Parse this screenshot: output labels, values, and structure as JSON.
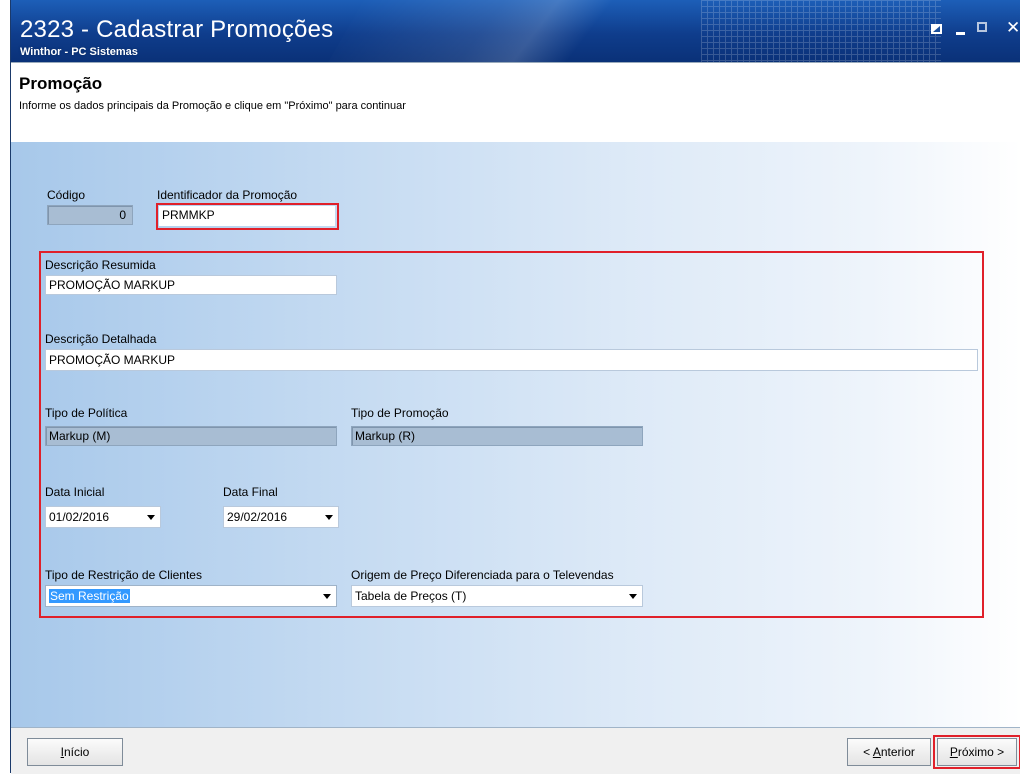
{
  "window": {
    "title": "2323 - Cadastrar Promoções",
    "subtitle": "Winthor - PC Sistemas"
  },
  "header": {
    "title": "Promoção",
    "description": "Informe os dados principais da Promoção e clique em \"Próximo\" para continuar"
  },
  "form": {
    "codigo": {
      "label": "Código",
      "value": "0"
    },
    "identificador": {
      "label": "Identificador da Promoção",
      "value": "PRMMKP"
    },
    "descricao_resumida": {
      "label": "Descrição Resumida",
      "value": "PROMOÇÃO MARKUP"
    },
    "descricao_detalhada": {
      "label": "Descrição Detalhada",
      "value": "PROMOÇÃO MARKUP"
    },
    "tipo_politica": {
      "label": "Tipo de Política",
      "value": "Markup (M)"
    },
    "tipo_promocao": {
      "label": "Tipo de Promoção",
      "value": "Markup (R)"
    },
    "data_inicial": {
      "label": "Data Inicial",
      "value": "01/02/2016"
    },
    "data_final": {
      "label": "Data Final",
      "value": "29/02/2016"
    },
    "tipo_restricao": {
      "label": "Tipo de Restrição de Clientes",
      "value": "Sem Restrição"
    },
    "origem_preco": {
      "label": "Origem de Preço Diferenciada para o Televendas",
      "value": "Tabela de Preços (T)"
    }
  },
  "buttons": {
    "inicio": {
      "accel": "I",
      "rest": "nício"
    },
    "anterior": {
      "prefix": "< ",
      "accel": "A",
      "rest": "nterior"
    },
    "proximo": {
      "accel": "P",
      "rest": "róximo >"
    }
  },
  "colors": {
    "title_bar": "#0f3d8c",
    "highlight_border": "#e0202a",
    "disabled_field": "#a8bdd3",
    "selection": "#3399ff"
  }
}
